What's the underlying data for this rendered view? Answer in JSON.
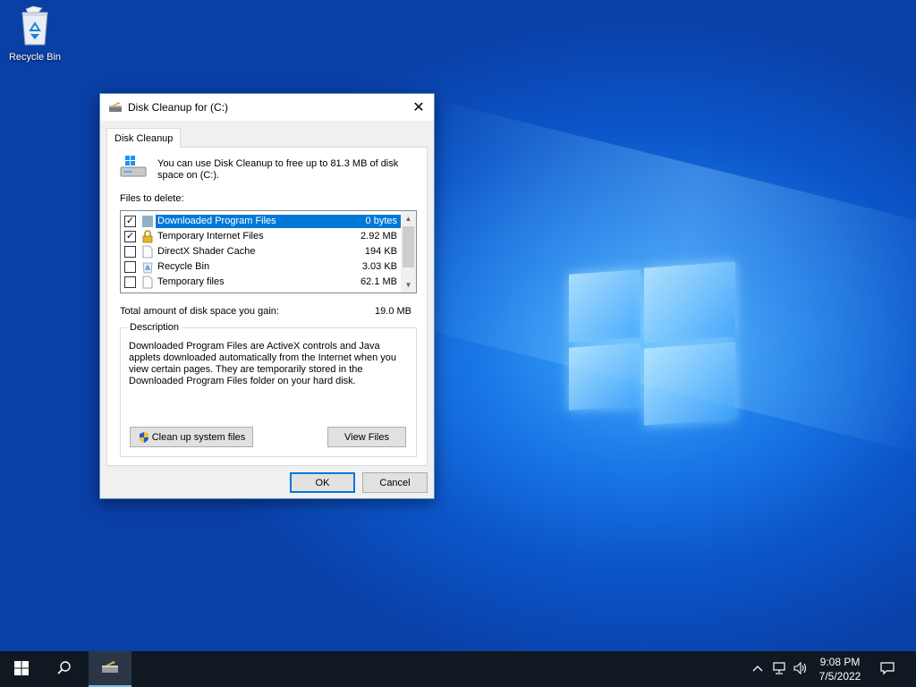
{
  "desktop": {
    "recycle_bin_label": "Recycle Bin"
  },
  "dialog": {
    "title": "Disk Cleanup for  (C:)",
    "close_glyph": "✕",
    "tab_label": "Disk Cleanup",
    "intro_text": "You can use Disk Cleanup to free up to 81.3 MB of disk space on  (C:).",
    "files_to_delete_label": "Files to delete:",
    "files": [
      {
        "name": "Downloaded Program Files",
        "size": "0 bytes",
        "checked": true,
        "selected": true,
        "icon": "folder-icon"
      },
      {
        "name": "Temporary Internet Files",
        "size": "2.92 MB",
        "checked": true,
        "selected": false,
        "icon": "lock-icon"
      },
      {
        "name": "DirectX Shader Cache",
        "size": "194 KB",
        "checked": false,
        "selected": false,
        "icon": "file-icon"
      },
      {
        "name": "Recycle Bin",
        "size": "3.03 KB",
        "checked": false,
        "selected": false,
        "icon": "recycle-bin-icon"
      },
      {
        "name": "Temporary files",
        "size": "62.1 MB",
        "checked": false,
        "selected": false,
        "icon": "file-icon"
      }
    ],
    "total_label": "Total amount of disk space you gain:",
    "total_value": "19.0 MB",
    "description_label": "Description",
    "description_text": "Downloaded Program Files are ActiveX controls and Java applets downloaded automatically from the Internet when you view certain pages. They are temporarily stored in the Downloaded Program Files folder on your hard disk.",
    "cleanup_system_files_label": "Clean up system files",
    "view_files_label": "View Files",
    "ok_label": "OK",
    "cancel_label": "Cancel"
  },
  "taskbar": {
    "time": "9:08 PM",
    "date": "7/5/2022"
  },
  "colors": {
    "accent": "#0078d7",
    "taskbar": "#101822"
  }
}
